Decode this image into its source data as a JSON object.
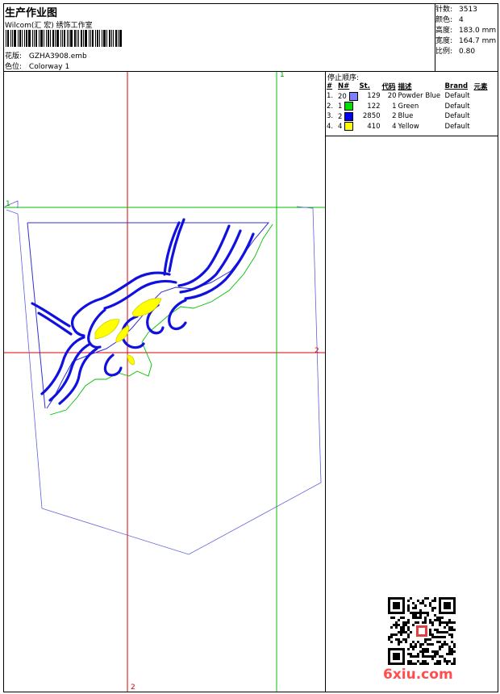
{
  "header": {
    "title": "生产作业图",
    "company": "Wilcom(汇 宏) 绣饰工作室",
    "design_label": "花版:",
    "design_file": "GZHA3908.emb",
    "colorway_label": "色位:",
    "colorway": "Colorway 1"
  },
  "stats": [
    {
      "label": "针数:",
      "value": "3513"
    },
    {
      "label": "颜色:",
      "value": "4"
    },
    {
      "label": "高度:",
      "value": "183.0 mm"
    },
    {
      "label": "宽度:",
      "value": "164.7 mm"
    },
    {
      "label": "比例:",
      "value": "0.80"
    }
  ],
  "stop_sequence": {
    "title": "停止顺序:",
    "headers": [
      "#",
      "N#",
      "St.",
      "代码",
      "描述",
      "Brand",
      "元素"
    ],
    "rows": [
      {
        "idx": "1.",
        "n": "20",
        "st": "129",
        "code": "20",
        "desc": "Powder Blue",
        "brand": "Default",
        "color": "#7f7fff"
      },
      {
        "idx": "2.",
        "n": "1",
        "st": "122",
        "code": "1",
        "desc": "Green",
        "brand": "Default",
        "color": "#00e000"
      },
      {
        "idx": "3.",
        "n": "2",
        "st": "2850",
        "code": "2",
        "desc": "Blue",
        "brand": "Default",
        "color": "#0000ee"
      },
      {
        "idx": "4.",
        "n": "4",
        "st": "410",
        "code": "4",
        "desc": "Yellow",
        "brand": "Default",
        "color": "#ffff00"
      }
    ]
  },
  "axes": {
    "v1": "1",
    "h1": "1",
    "h2": "2",
    "v2": "2"
  },
  "watermark": "6xiu.com"
}
